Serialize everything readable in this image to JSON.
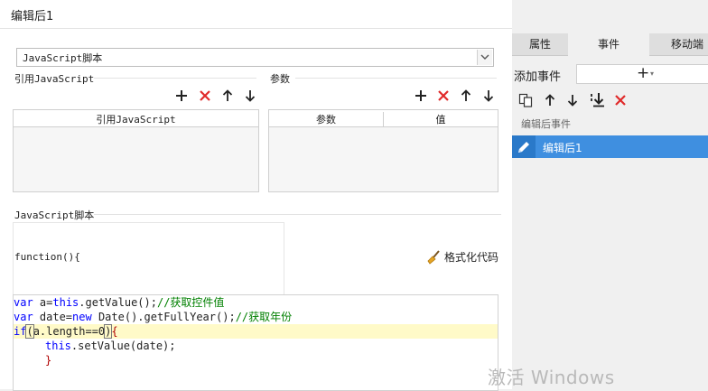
{
  "dialog": {
    "title": "编辑后1",
    "type_select": {
      "value": "JavaScript脚本"
    },
    "ref_section": {
      "label": "引用JavaScript",
      "table_headers": [
        "引用JavaScript"
      ]
    },
    "params_section": {
      "label": "参数",
      "table_headers": [
        "参数",
        "值"
      ]
    },
    "toolbar_icons": [
      "plus-icon",
      "delete-icon",
      "arrow-up-icon",
      "arrow-down-icon"
    ],
    "script_section": {
      "label": "JavaScript脚本",
      "function_signature": "function(){",
      "format_button": "格式化代码"
    },
    "code": {
      "line1": {
        "kw1": "var",
        "t1": " a=",
        "kw2": "this",
        "t2": ".getValue();",
        "comment": "//获取控件值"
      },
      "line2": {
        "kw1": "var",
        "t1": " date=",
        "kw2": "new",
        "t2": " Date().getFullYear();",
        "comment": "//获取年份"
      },
      "line3": {
        "kw1": "if",
        "b1": "(",
        "t1": "a.length==0",
        "b2": ")",
        "t2": "{"
      },
      "line4": {
        "kw1": "this",
        "t1": ".setValue(date);"
      },
      "line5": {
        "t1": "}"
      }
    }
  },
  "panel": {
    "tabs": [
      "属性",
      "事件",
      "移动端"
    ],
    "active_tab": "事件",
    "add_event_label": "添加事件",
    "add_event_plus": "+",
    "add_event_caret": "▾",
    "event_toolbar_icons": [
      "copy-icon",
      "arrow-up-icon",
      "arrow-down-icon",
      "move-bottom-icon",
      "delete-icon"
    ],
    "events_header": "编辑后事件",
    "events": [
      {
        "label": "编辑后1",
        "selected": true
      }
    ]
  },
  "watermark": "激活 Windows",
  "colors": {
    "selection_blue": "#3f8fe0",
    "delete_red": "#e02a2a",
    "keyword_blue": "#0000ff",
    "comment_green": "#008000",
    "highlight_line": "#fffac8"
  }
}
